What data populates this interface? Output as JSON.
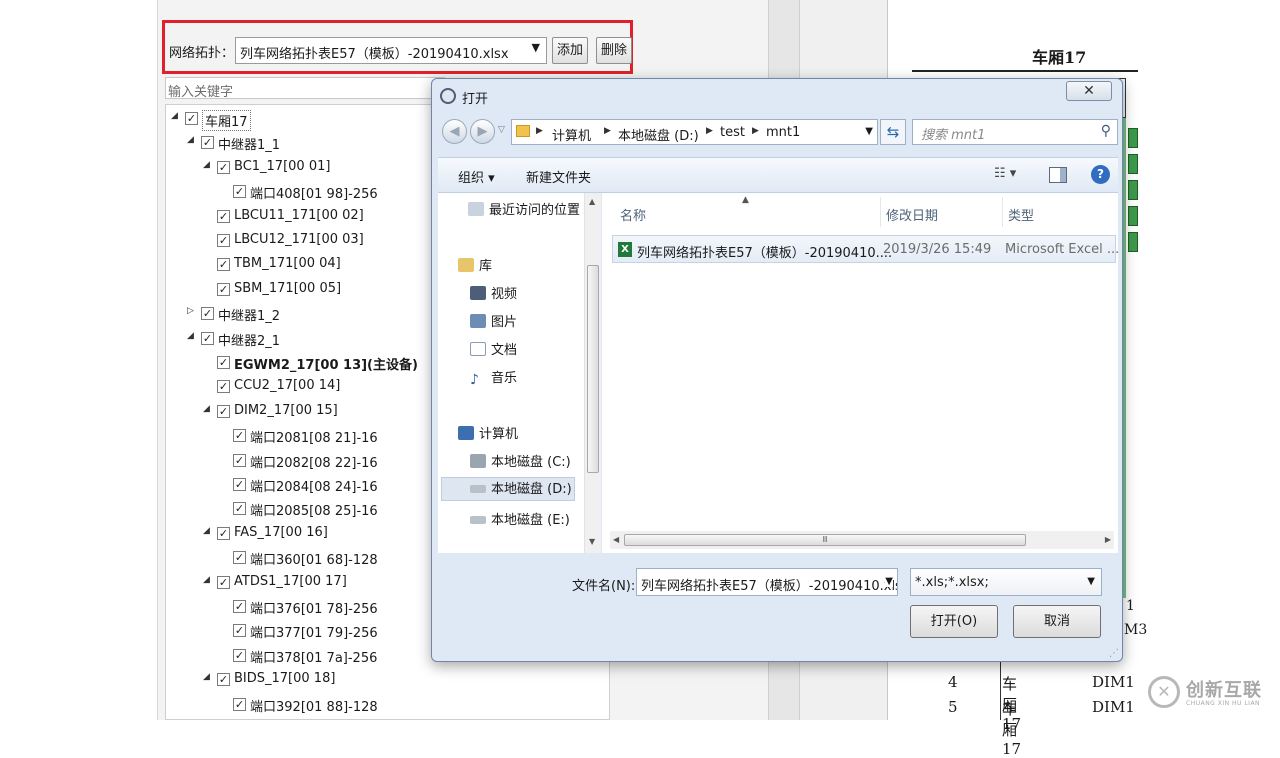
{
  "app": {
    "topology_label": "网络拓扑：",
    "topology_value": "列车网络拓扑表E57（模板）-20190410.xlsx",
    "add_label": "添加",
    "delete_label": "删除",
    "keyword_placeholder": "输入关键字",
    "tree": [
      {
        "label": "车厢17",
        "depth": 0,
        "expanded": true,
        "checked": true,
        "bold": false
      },
      {
        "label": "中继器1_1",
        "depth": 1,
        "expanded": true,
        "checked": true,
        "bold": false
      },
      {
        "label": "BC1_17[00 01]",
        "depth": 2,
        "expanded": true,
        "checked": true,
        "bold": false
      },
      {
        "label": "端口408[01 98]-256",
        "depth": 3,
        "checked": true,
        "bold": false
      },
      {
        "label": "LBCU11_171[00 02]",
        "depth": 2,
        "checked": true,
        "bold": false
      },
      {
        "label": "LBCU12_171[00 03]",
        "depth": 2,
        "checked": true,
        "bold": false
      },
      {
        "label": "TBM_171[00 04]",
        "depth": 2,
        "checked": true,
        "bold": false
      },
      {
        "label": "SBM_171[00 05]",
        "depth": 2,
        "checked": true,
        "bold": false
      },
      {
        "label": "中继器1_2",
        "depth": 1,
        "expanded": false,
        "checked": true,
        "bold": false
      },
      {
        "label": "中继器2_1",
        "depth": 1,
        "expanded": true,
        "checked": true,
        "bold": false
      },
      {
        "label": "EGWM2_17[00 13](主设备)",
        "depth": 2,
        "checked": true,
        "bold": true
      },
      {
        "label": "CCU2_17[00 14]",
        "depth": 2,
        "checked": true,
        "bold": false
      },
      {
        "label": "DIM2_17[00 15]",
        "depth": 2,
        "expanded": true,
        "checked": true,
        "bold": false
      },
      {
        "label": "端口2081[08 21]-16",
        "depth": 3,
        "checked": true,
        "bold": false
      },
      {
        "label": "端口2082[08 22]-16",
        "depth": 3,
        "checked": true,
        "bold": false
      },
      {
        "label": "端口2084[08 24]-16",
        "depth": 3,
        "checked": true,
        "bold": false
      },
      {
        "label": "端口2085[08 25]-16",
        "depth": 3,
        "checked": true,
        "bold": false
      },
      {
        "label": "FAS_17[00 16]",
        "depth": 2,
        "expanded": true,
        "checked": true,
        "bold": false
      },
      {
        "label": "端口360[01 68]-128",
        "depth": 3,
        "checked": true,
        "bold": false
      },
      {
        "label": "ATDS1_17[00 17]",
        "depth": 2,
        "expanded": true,
        "checked": true,
        "bold": false
      },
      {
        "label": "端口376[01 78]-256",
        "depth": 3,
        "checked": true,
        "bold": false
      },
      {
        "label": "端口377[01 79]-256",
        "depth": 3,
        "checked": true,
        "bold": false
      },
      {
        "label": "端口378[01 7a]-256",
        "depth": 3,
        "checked": true,
        "bold": false
      },
      {
        "label": "BIDS_17[00 18]",
        "depth": 2,
        "expanded": true,
        "checked": true,
        "bold": false
      },
      {
        "label": "端口392[01 88]-128",
        "depth": 3,
        "checked": true,
        "bold": false
      }
    ]
  },
  "document": {
    "title": "车厢17",
    "rows": [
      {
        "no": "4",
        "car": "车厢17",
        "dev": "DIM1"
      },
      {
        "no": "5",
        "car": "车厢17",
        "dev": "DIM1"
      }
    ],
    "partial_labels": [
      "1",
      "M3"
    ]
  },
  "dialog": {
    "title": "打开",
    "close_glyph": "✕",
    "path": [
      "计算机",
      "本地磁盘 (D:)",
      "test",
      "mnt1"
    ],
    "search_placeholder": "搜索 mnt1",
    "toolbar": {
      "organize": "组织 ▾",
      "new_folder": "新建文件夹",
      "view": "☷ ▾",
      "help": "?"
    },
    "nav_items": [
      {
        "label": "最近访问的位置",
        "icon": "recent-places-icon"
      },
      {
        "label": "库",
        "icon": "library-icon"
      },
      {
        "label": "视频",
        "icon": "video-icon"
      },
      {
        "label": "图片",
        "icon": "picture-icon"
      },
      {
        "label": "文档",
        "icon": "document-icon"
      },
      {
        "label": "音乐",
        "icon": "music-icon"
      },
      {
        "label": "计算机",
        "icon": "computer-icon"
      },
      {
        "label": "本地磁盘 (C:)",
        "icon": "system-drive-icon"
      },
      {
        "label": "本地磁盘 (D:)",
        "icon": "drive-icon",
        "selected": true
      },
      {
        "label": "本地磁盘 (E:)",
        "icon": "drive-icon"
      }
    ],
    "columns": {
      "name": "名称",
      "date": "修改日期",
      "type": "类型"
    },
    "files": [
      {
        "name": "列车网络拓扑表E57（模板）-20190410....",
        "date": "2019/3/26 15:49",
        "type": "Microsoft Excel ..."
      }
    ],
    "filename_label": "文件名(N):",
    "filename_value": "列车网络拓扑表E57（模板）-20190410.xls:",
    "filetype_value": "*.xls;*.xlsx;",
    "open_label": "打开(O)",
    "cancel_label": "取消",
    "hscroll_grip": "Ⅲ"
  },
  "watermark": {
    "brand": "创新互联",
    "sub": "CHUANG XIN HU LIAN"
  },
  "colors": {
    "highlight_border": "#e0212b",
    "dialog_bg": "#dfe9f6",
    "accent": "#2f6cc2"
  }
}
